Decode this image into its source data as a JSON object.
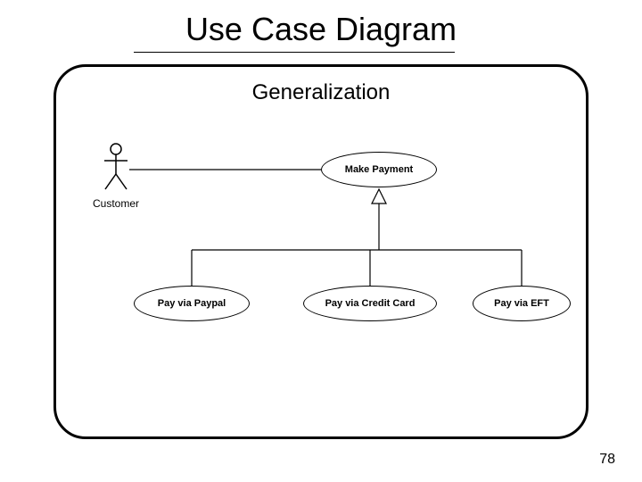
{
  "title": "Use Case Diagram",
  "subtitle": "Generalization",
  "page_number": "78",
  "actor": {
    "label": "Customer"
  },
  "usecases": {
    "parent": "Make Payment",
    "children": [
      "Pay via Paypal",
      "Pay via Credit Card",
      "Pay via EFT"
    ]
  },
  "relationships": {
    "association": {
      "from": "Customer",
      "to": "Make Payment"
    },
    "generalizations": [
      {
        "child": "Pay via Paypal",
        "parent": "Make Payment"
      },
      {
        "child": "Pay via Credit Card",
        "parent": "Make Payment"
      },
      {
        "child": "Pay via EFT",
        "parent": "Make Payment"
      }
    ]
  }
}
